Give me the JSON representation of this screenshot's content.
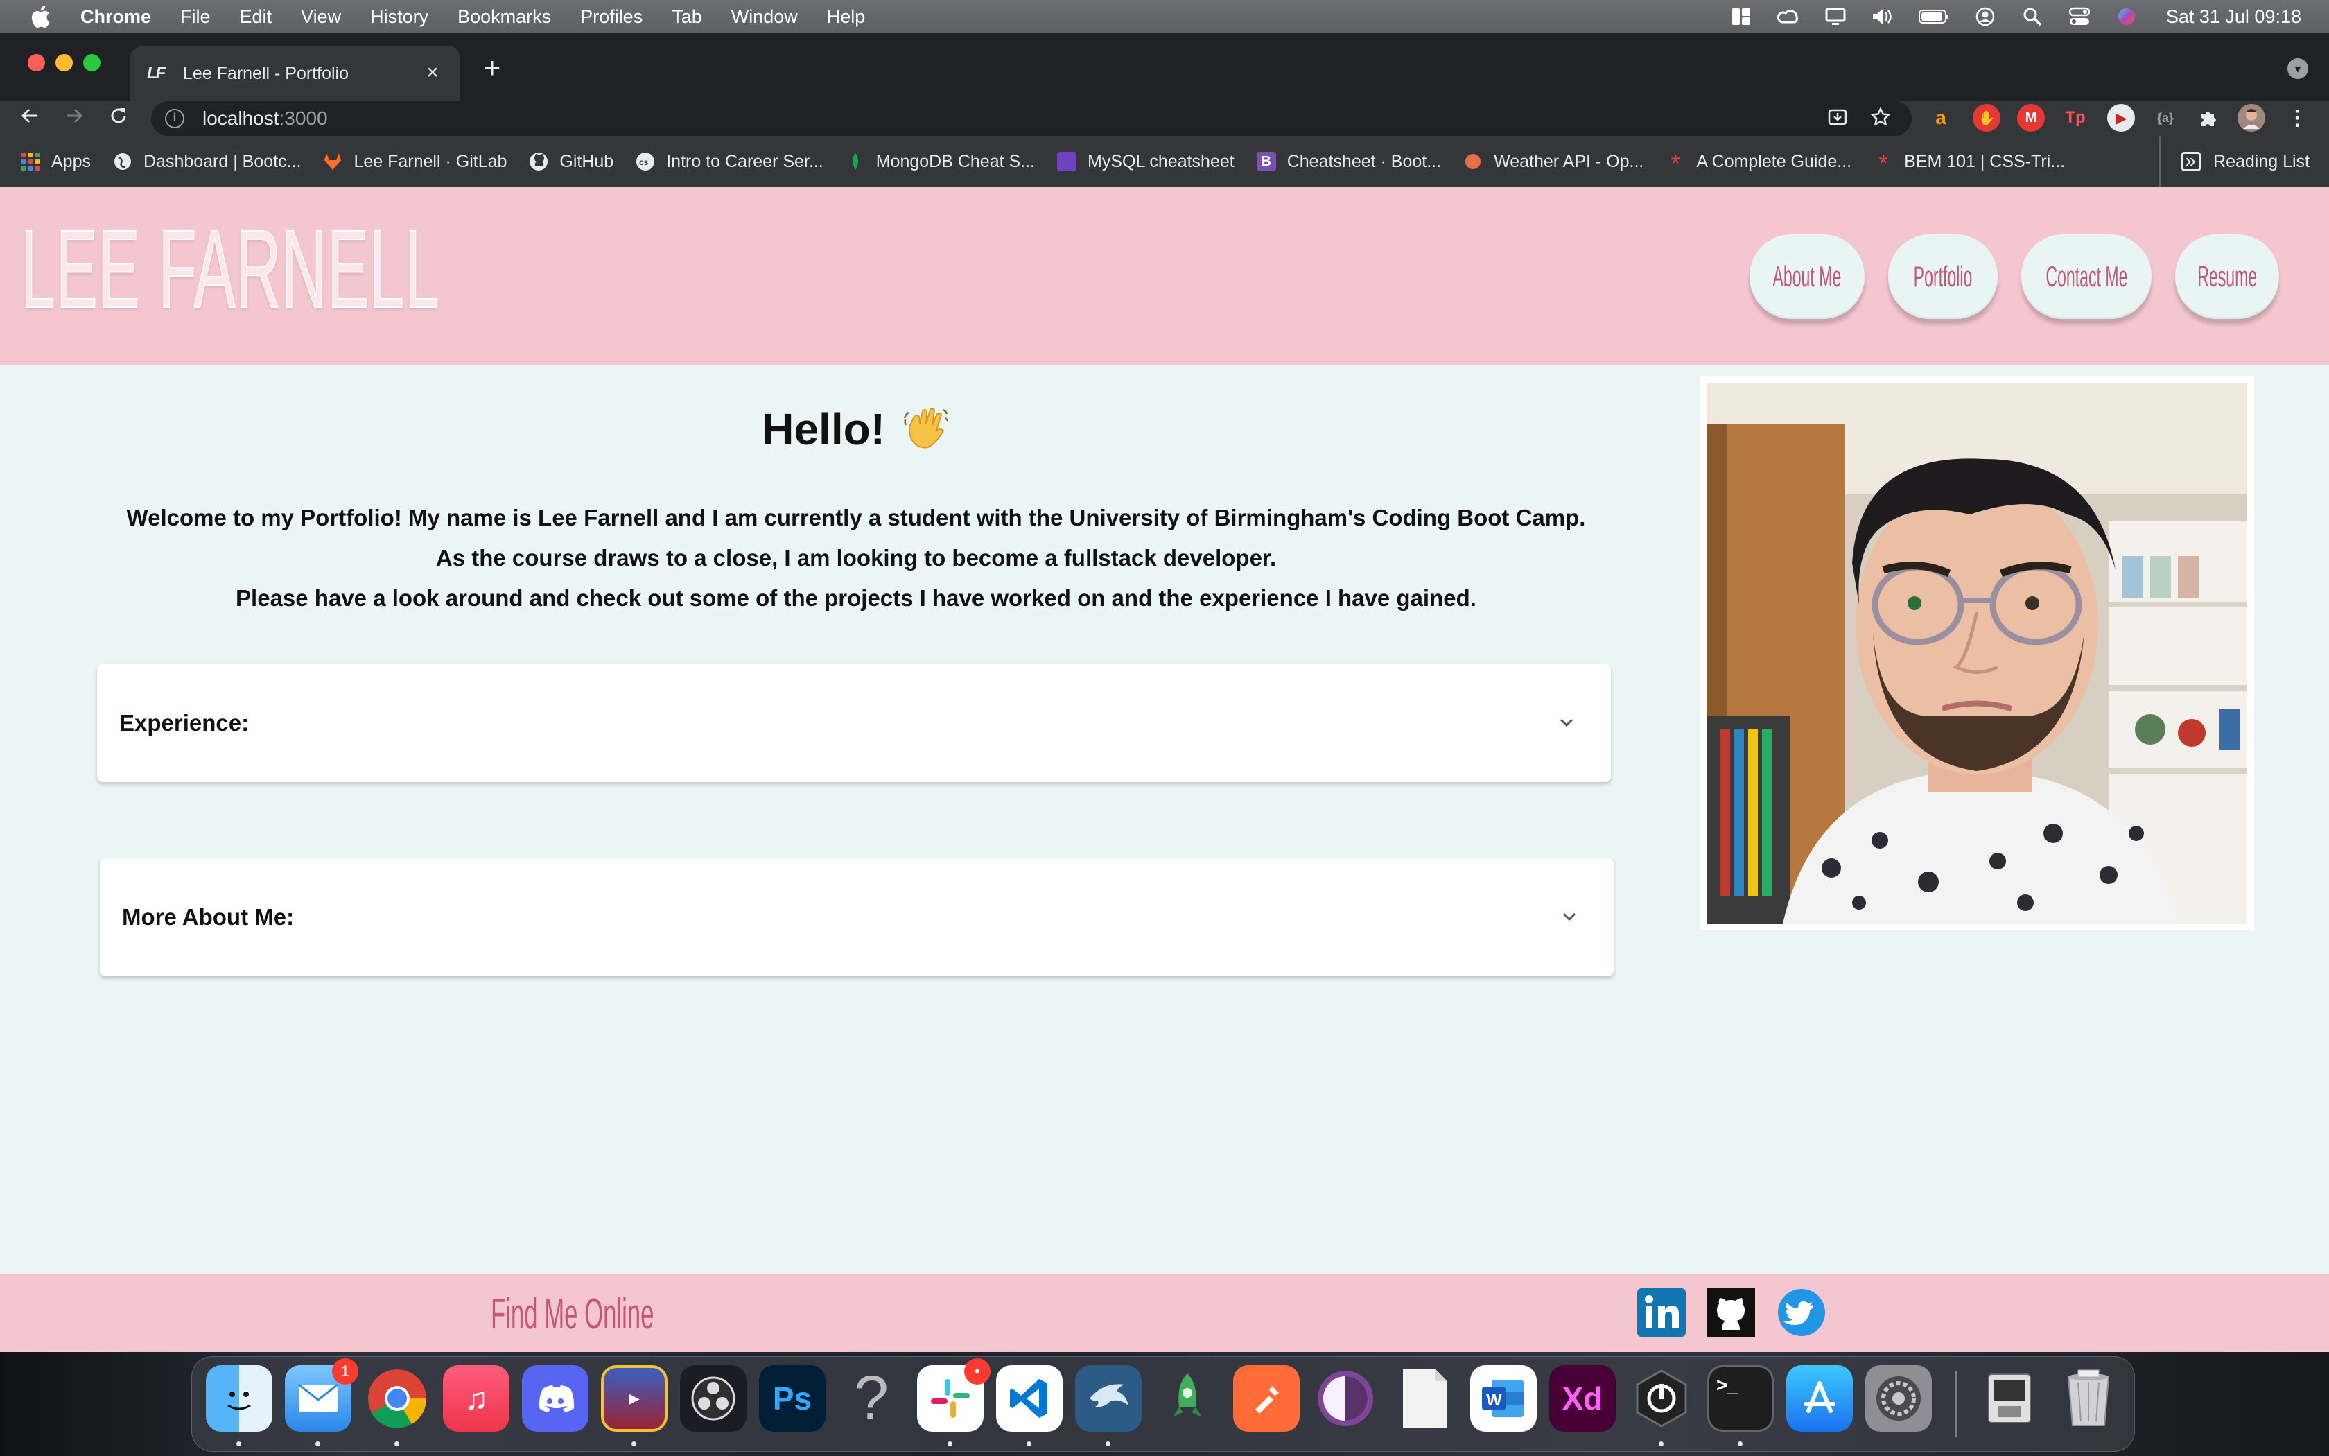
{
  "menubar": {
    "app_name": "Chrome",
    "items": [
      "File",
      "Edit",
      "View",
      "History",
      "Bookmarks",
      "Profiles",
      "Tab",
      "Window",
      "Help"
    ],
    "clock": "Sat 31 Jul  09:18"
  },
  "browser": {
    "tab_title": "Lee Farnell - Portfolio",
    "tab_favicon": "LF",
    "address_host": "localhost",
    "address_port": ":3000",
    "bookmarks": [
      {
        "label": "Apps",
        "icon": "apps-grid-icon",
        "color": "#e8453c"
      },
      {
        "label": "Dashboard | Bootc...",
        "icon": "globe-icon",
        "color": "#e8eaed"
      },
      {
        "label": "Lee Farnell · GitLab",
        "icon": "gitlab-icon",
        "color": "#fc6d26"
      },
      {
        "label": "GitHub",
        "icon": "github-icon",
        "color": "#e8eaed"
      },
      {
        "label": "Intro to Career Ser...",
        "icon": "cs-icon",
        "color": "#e8eaed"
      },
      {
        "label": "MongoDB Cheat S...",
        "icon": "mongodb-leaf-icon",
        "color": "#13aa52"
      },
      {
        "label": "MySQL cheatsheet",
        "icon": "devhints-icon",
        "color": "#6f42c1"
      },
      {
        "label": "Cheatsheet · Boot...",
        "icon": "bootstrap-icon",
        "color": "#7952b3"
      },
      {
        "label": "Weather API - Op...",
        "icon": "openweather-icon",
        "color": "#eb6e4b"
      },
      {
        "label": "A Complete Guide...",
        "icon": "css-tricks-icon",
        "color": "#e8453c"
      },
      {
        "label": "BEM 101 | CSS-Tri...",
        "icon": "css-tricks-icon",
        "color": "#e8453c"
      }
    ],
    "more": "»",
    "reading_list": "Reading List"
  },
  "site": {
    "logo": "LEE FARNELL",
    "nav": [
      "About Me",
      "Portfolio",
      "Contact Me",
      "Resume"
    ],
    "hello": "Hello!",
    "intro_lines": [
      "Welcome to my Portfolio! My name is Lee Farnell and I am currently a student with the University of Birmingham's Coding Boot Camp.",
      "As the course draws to a close, I am looking to become a fullstack developer.",
      "Please have a look around and check out some of the projects I have worked on and the experience I have gained."
    ],
    "accordions": [
      "Experience:",
      "More About Me:"
    ],
    "footer_title": "Find Me Online",
    "social": [
      "linkedin-icon",
      "github-icon",
      "twitter-icon"
    ],
    "colors": {
      "header_bg": "#f4c6cf",
      "page_bg": "#ecf5f6",
      "accent": "#c25876"
    }
  },
  "dock": {
    "apps": [
      "Finder",
      "Mail",
      "Chrome",
      "Music",
      "Discord",
      "Pokémon TCG Online",
      "OBS",
      "Photoshop",
      "Help",
      "Slack",
      "VS Code",
      "MySQL Workbench",
      "Robo 3T",
      "Postman",
      "Tor",
      "Document",
      "Word",
      "Adobe XD",
      "Logi Options",
      "Terminal",
      "App Store",
      "System Preferences",
      "Downloads",
      "Trash"
    ],
    "mail_badge": "1",
    "slack_badge": "•"
  }
}
